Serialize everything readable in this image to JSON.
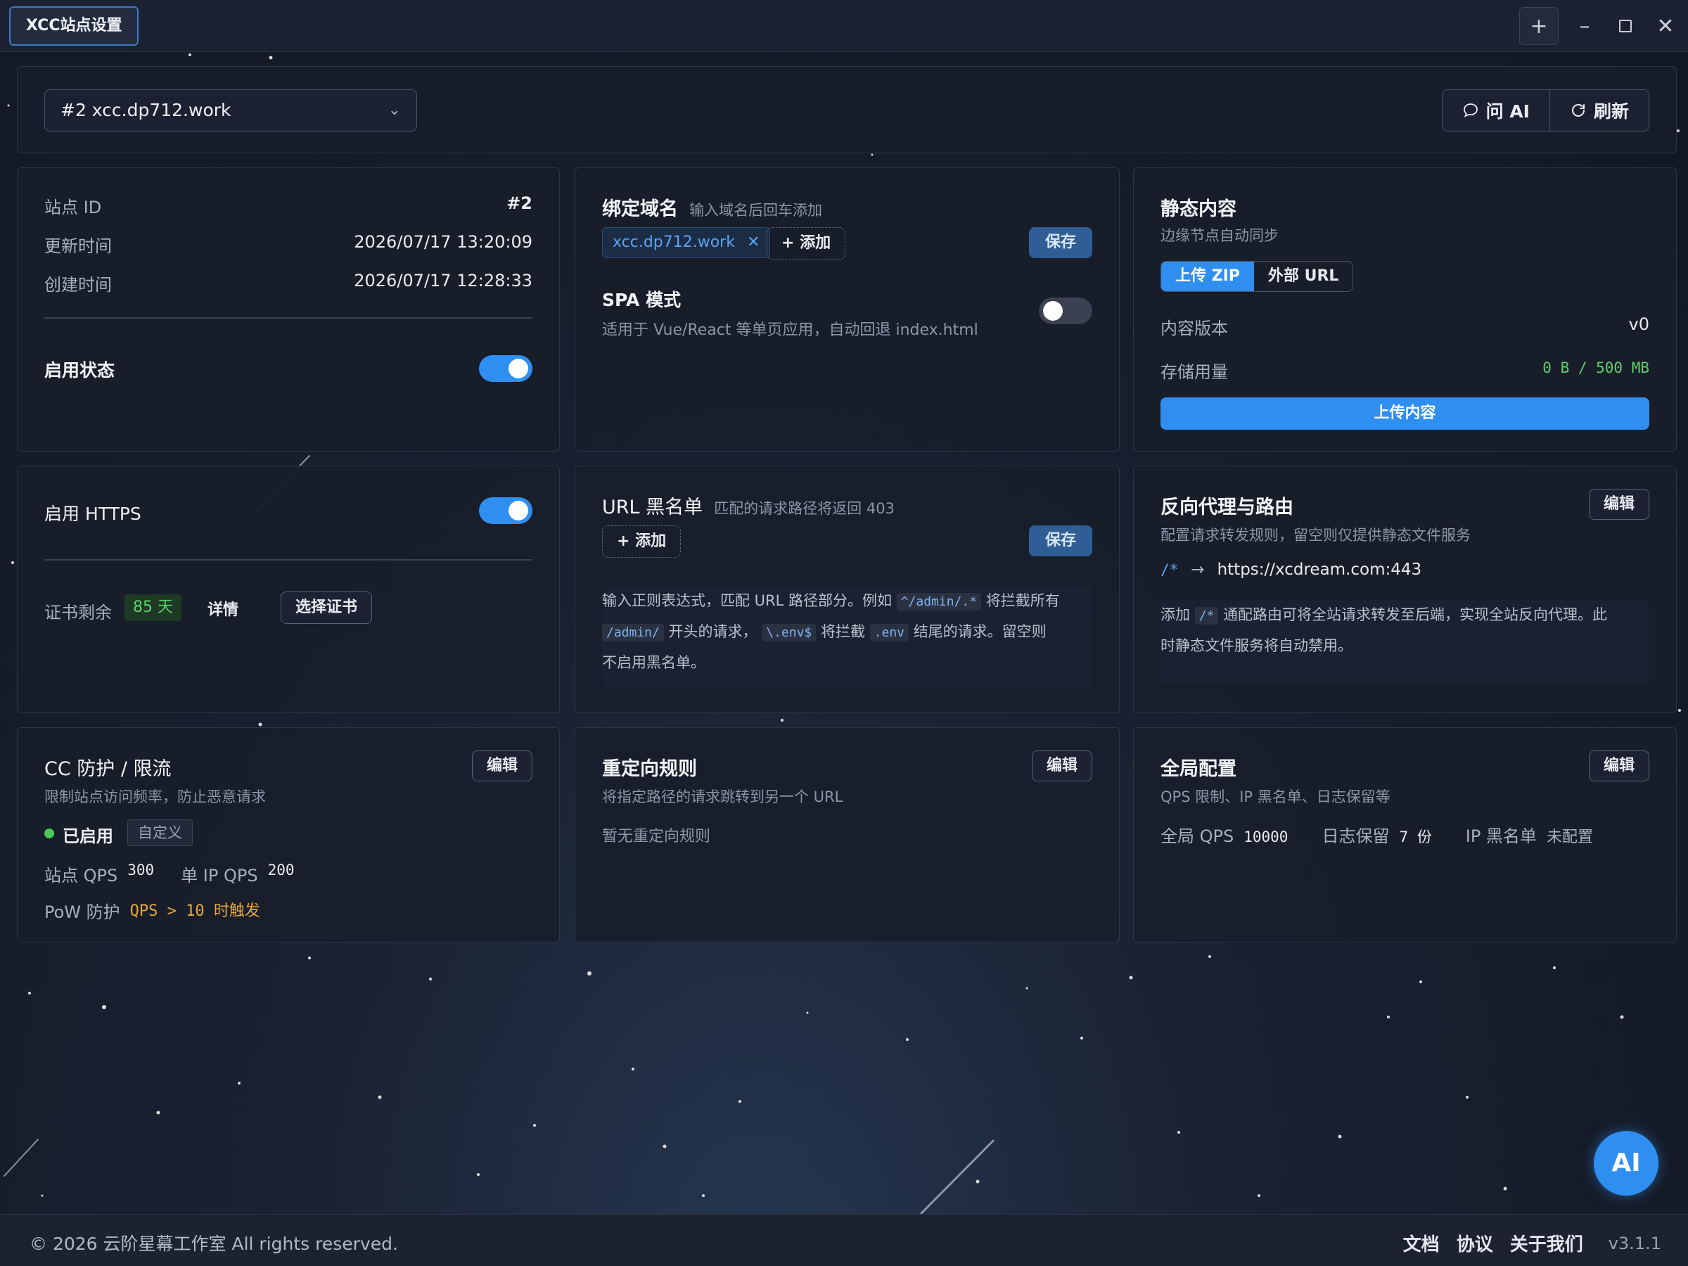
{
  "window": {
    "tab_title": "XCC站点设置",
    "new_tab_icon": "plus-icon",
    "controls": [
      "minimize-icon",
      "maximize-icon",
      "close-icon"
    ]
  },
  "topbar": {
    "site_selected": "#2 xcc.dp712.work",
    "ask_ai_label": "问 AI",
    "refresh_label": "刷新"
  },
  "site_info": {
    "id_label": "站点 ID",
    "id_value": "#2",
    "updated_label": "更新时间",
    "updated_value": "2026/07/17 13:20:09",
    "created_label": "创建时间",
    "created_value": "2026/07/17 12:28:33",
    "enabled_label": "启用状态",
    "enabled": true
  },
  "domains": {
    "title": "绑定域名",
    "hint": "输入域名后回车添加",
    "tags": [
      "xcc.dp712.work"
    ],
    "add_label": "+ 添加",
    "save_label": "保存",
    "spa_title": "SPA 模式",
    "spa_desc": "适用于 Vue/React 等单页应用，自动回退 index.html",
    "spa_enabled": false
  },
  "static": {
    "title": "静态内容",
    "subtitle": "边缘节点自动同步",
    "tab_zip": "上传 ZIP",
    "tab_url": "外部 URL",
    "version_label": "内容版本",
    "version_value": "v0",
    "storage_label": "存储用量",
    "storage_value": "0 B / 500 MB",
    "upload_label": "上传内容"
  },
  "https": {
    "enabled_label": "启用 HTTPS",
    "enabled": true,
    "cert_label": "证书剩余",
    "cert_days": "85 天",
    "detail_label": "详情",
    "choose_cert_label": "选择证书"
  },
  "blacklist": {
    "title": "URL 黑名单",
    "hint": "匹配的请求路径将返回 403",
    "add_label": "+ 添加",
    "save_label": "保存",
    "help_1": "输入正则表达式，匹配 URL 路径部分。例如",
    "code_1": "^/admin/.*",
    "help_2": "将拦截所有",
    "code_2": "/admin/",
    "help_3": "开头的请求，",
    "code_3": "\\.env$",
    "help_4": "将拦截",
    "code_4": ".env",
    "help_5": "结尾的请求。留空则",
    "help_6": "不启用黑名单。"
  },
  "proxy": {
    "title": "反向代理与路由",
    "subtitle": "配置请求转发规则，留空则仅提供静态文件服务",
    "edit_label": "编辑",
    "route_path": "/*",
    "route_arrow": "→",
    "route_target": "https://xcdream.com:443",
    "note_1": "添加",
    "note_code": "/*",
    "note_2": "通配路由可将全站请求转发至后端，实现全站反向代理。此",
    "note_3": "时静态文件服务将自动禁用。"
  },
  "cc": {
    "title": "CC 防护 / 限流",
    "subtitle": "限制站点访问频率，防止恶意请求",
    "edit_label": "编辑",
    "status": "已启用",
    "mode": "自定义",
    "site_qps_label": "站点 QPS",
    "site_qps_value": "300",
    "ip_qps_label": "单 IP QPS",
    "ip_qps_value": "200",
    "pow_label": "PoW 防护",
    "pow_value": "QPS > 10 时触发"
  },
  "redirect": {
    "title": "重定向规则",
    "subtitle": "将指定路径的请求跳转到另一个 URL",
    "edit_label": "编辑",
    "empty": "暂无重定向规则"
  },
  "global": {
    "title": "全局配置",
    "subtitle": "QPS 限制、IP 黑名单、日志保留等",
    "edit_label": "编辑",
    "qps_label": "全局 QPS",
    "qps_value": "10000",
    "log_label": "日志保留",
    "log_value": "7 份",
    "ipbl_label": "IP 黑名单",
    "ipbl_value": "未配置"
  },
  "footer": {
    "copyright": "© 2026 云阶星幕工作室 All rights reserved.",
    "docs": "文档",
    "terms": "协议",
    "about": "关于我们",
    "version": "v3.1.1"
  },
  "fab": {
    "label": "AI"
  },
  "colors": {
    "accent": "#2f8ff0",
    "success": "#5fd16a",
    "warning": "#e8a93c"
  }
}
